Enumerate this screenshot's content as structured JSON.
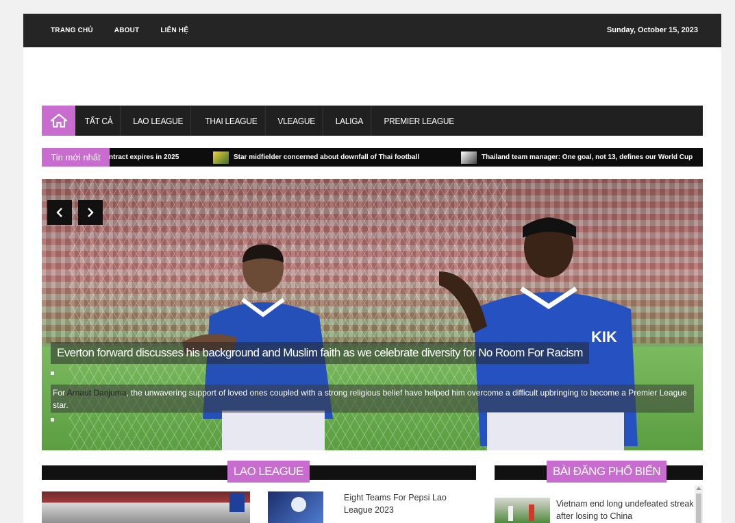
{
  "topbar": {
    "nav": [
      "TRANG CHỦ",
      "ABOUT",
      "LIÊN HỆ"
    ],
    "date": "Sunday, October 15, 2023"
  },
  "mainnav": {
    "home_icon": "home-icon",
    "items": [
      "TẤT CẢ",
      "LAO LEAGUE",
      "THAI LEAGUE",
      "VLEAGUE",
      "LALIGA",
      "PREMIER LEAGUE"
    ]
  },
  "ticker": {
    "label": "Tin mới nhất",
    "items": [
      "ntract expires in 2025",
      "Star midfielder concerned about downfall of Thai football",
      "Thailand team manager: One goal, not 13, defines our World Cup"
    ]
  },
  "slider": {
    "prev_icon": "chevron-left-icon",
    "next_icon": "chevron-right-icon",
    "headline": "Everton forward discusses his background and Muslim faith as we celebrate diversity for No Room For Racism",
    "excerpt_before": "For ",
    "excerpt_name": "Arnaut Danjuma",
    "excerpt_after": ", the unwavering support of loved ones coupled with a strong religious belief have helped him overcome a difficult upbringing to become a Premier League star."
  },
  "sections": {
    "lao_league": {
      "title": "LAO LEAGUE",
      "post_title": "Eight Teams For Pepsi Lao League 2023"
    },
    "popular": {
      "title": "BÀI ĐĂNG PHỔ BIẾN",
      "post_title": "Vietnam end long undefeated streak after losing to China"
    }
  },
  "colors": {
    "accent": "#c96cd0",
    "dark": "#202020"
  }
}
